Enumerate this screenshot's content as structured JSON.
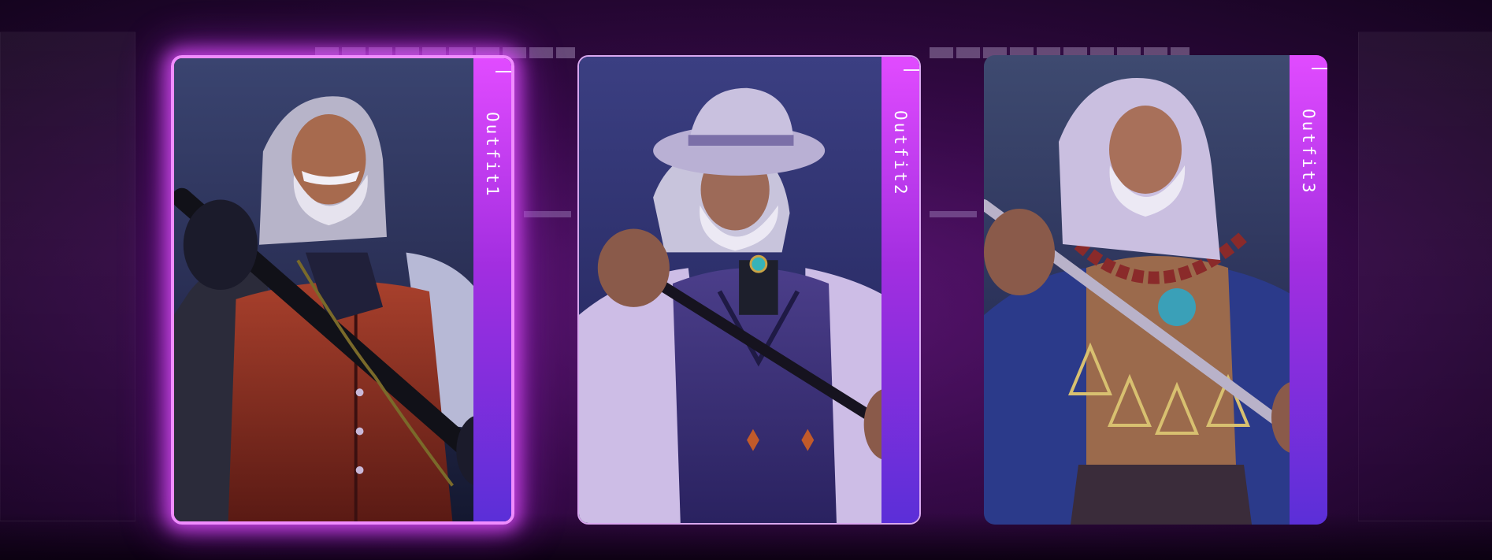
{
  "screen": {
    "name": "outfit-selection"
  },
  "colors": {
    "accent": "#e14bff",
    "selected_glow": "#f08cff",
    "background": "#2a0838"
  },
  "outfits": [
    {
      "label": "Outfit1",
      "selected": true
    },
    {
      "label": "Outfit2",
      "selected": false
    },
    {
      "label": "Outfit3",
      "selected": false
    }
  ]
}
